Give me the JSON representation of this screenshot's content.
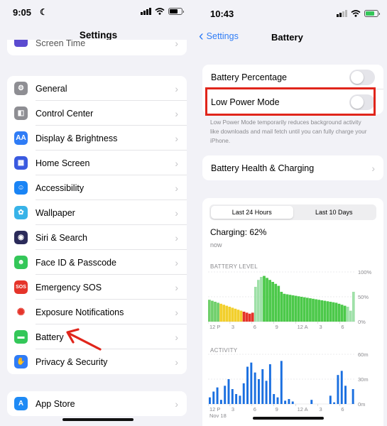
{
  "left": {
    "status": {
      "time": "9:05"
    },
    "title": "Settings",
    "partial_row": {
      "label": "Screen Time"
    },
    "group1": [
      {
        "label": "General",
        "icon": "gear-icon",
        "color": "#8e8e93",
        "glyph": "⚙"
      },
      {
        "label": "Control Center",
        "icon": "toggles-icon",
        "color": "#8e8e93",
        "glyph": "◧"
      },
      {
        "label": "Display & Brightness",
        "icon": "text-size-icon",
        "color": "#2f7cf6",
        "glyph": "AA"
      },
      {
        "label": "Home Screen",
        "icon": "app-grid-icon",
        "color": "#3a5ae0",
        "glyph": "▦"
      },
      {
        "label": "Accessibility",
        "icon": "accessibility-icon",
        "color": "#1a84f5",
        "glyph": "☺"
      },
      {
        "label": "Wallpaper",
        "icon": "flower-icon",
        "color": "#38b3e8",
        "glyph": "✿"
      },
      {
        "label": "Siri & Search",
        "icon": "siri-icon",
        "color": "#2b2b5a",
        "glyph": "◉"
      },
      {
        "label": "Face ID & Passcode",
        "icon": "face-id-icon",
        "color": "#34c759",
        "glyph": "☻"
      },
      {
        "label": "Emergency SOS",
        "icon": "sos-icon",
        "color": "#e5342a",
        "glyph": "SOS"
      },
      {
        "label": "Exposure Notifications",
        "icon": "exposure-icon",
        "color": "#ffffff",
        "glyph": "✺"
      },
      {
        "label": "Battery",
        "icon": "battery-icon",
        "color": "#34c759",
        "glyph": "▬"
      },
      {
        "label": "Privacy & Security",
        "icon": "hand-icon",
        "color": "#2f7cf6",
        "glyph": "✋"
      }
    ],
    "group2": [
      {
        "label": "App Store",
        "icon": "app-store-icon",
        "color": "#1e8af5",
        "glyph": "A"
      }
    ],
    "annotation_arrow_color": "#e0251b"
  },
  "right": {
    "status": {
      "time": "10:43"
    },
    "back_label": "Settings",
    "title": "Battery",
    "battery_percentage": "Battery Percentage",
    "low_power_mode": "Low Power Mode",
    "low_power_caption": "Low Power Mode temporarily reduces background activity like downloads and mail fetch until you can fully charge your iPhone.",
    "battery_health": "Battery Health & Charging",
    "segments": [
      "Last 24 Hours",
      "Last 10 Days"
    ],
    "charging_status": "Charging: 62%",
    "charging_time": "now",
    "battery_level_label": "BATTERY LEVEL",
    "activity_label": "ACTIVITY",
    "highlight_color": "#e0251b"
  },
  "chart_data": [
    {
      "type": "bar",
      "title": "BATTERY LEVEL",
      "ylim": [
        0,
        100
      ],
      "y_ticks": [
        "100%",
        "50%",
        "0%"
      ],
      "x_ticks": [
        "12 P",
        "3",
        "6",
        "9",
        "12 A",
        "3",
        "6"
      ],
      "values": [
        44,
        42,
        40,
        38,
        36,
        34,
        32,
        30,
        28,
        26,
        24,
        22,
        20,
        18,
        16,
        18,
        70,
        84,
        90,
        92,
        88,
        84,
        80,
        76,
        72,
        60,
        56,
        55,
        54,
        53,
        52,
        51,
        50,
        49,
        48,
        47,
        46,
        45,
        44,
        43,
        42,
        41,
        40,
        39,
        38,
        36,
        34,
        32,
        30,
        22,
        60
      ]
    },
    {
      "type": "bar",
      "title": "ACTIVITY",
      "ylim": [
        0,
        60
      ],
      "y_ticks": [
        "60m",
        "30m",
        "0m"
      ],
      "x_ticks": [
        "12 P",
        "3",
        "6",
        "9",
        "12 A",
        "3",
        "6"
      ],
      "x_sublabel": "Nov 18",
      "values": [
        8,
        15,
        20,
        5,
        22,
        30,
        18,
        12,
        10,
        25,
        45,
        50,
        38,
        30,
        42,
        28,
        48,
        12,
        8,
        52,
        4,
        6,
        3,
        0,
        0,
        0,
        0,
        5,
        0,
        0,
        0,
        0,
        10,
        2,
        35,
        40,
        22,
        0,
        18
      ]
    }
  ]
}
